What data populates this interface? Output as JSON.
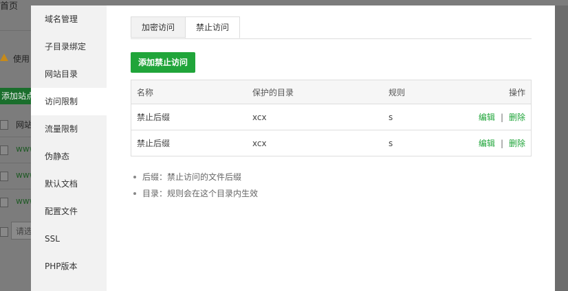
{
  "background": {
    "home_label": "首页",
    "warning_text": "使用",
    "add_site_button": "添加站点",
    "rows": [
      {
        "text": "网站",
        "dark": true
      },
      {
        "text": "www"
      },
      {
        "text": "www"
      },
      {
        "text": "www"
      }
    ],
    "search_placeholder": "请选"
  },
  "sidebar": {
    "items": [
      {
        "label": "域名管理"
      },
      {
        "label": "子目录绑定"
      },
      {
        "label": "网站目录"
      },
      {
        "label": "访问限制",
        "active": true
      },
      {
        "label": "流量限制"
      },
      {
        "label": "伪静态"
      },
      {
        "label": "默认文档"
      },
      {
        "label": "配置文件"
      },
      {
        "label": "SSL"
      },
      {
        "label": "PHP版本"
      }
    ]
  },
  "tabs": [
    {
      "label": "加密访问",
      "active": false
    },
    {
      "label": "禁止访问",
      "active": true
    }
  ],
  "add_button_label": "添加禁止访问",
  "table": {
    "headers": {
      "name": "名称",
      "dir": "保护的目录",
      "rule": "规则",
      "op": "操作"
    },
    "rows": [
      {
        "name": "禁止后缀",
        "dir": "xcx",
        "rule": "s",
        "edit": "编辑",
        "sep": "|",
        "delete": "删除"
      },
      {
        "name": "禁止后缀",
        "dir": "xcx",
        "rule": "s",
        "edit": "编辑",
        "sep": "|",
        "delete": "删除"
      }
    ]
  },
  "notes": [
    "后缀：禁止访问的文件后缀",
    "目录：规则会在这个目录内生效"
  ],
  "colors": {
    "accent": "#20a53a",
    "overlay": "#7c7c7c"
  }
}
